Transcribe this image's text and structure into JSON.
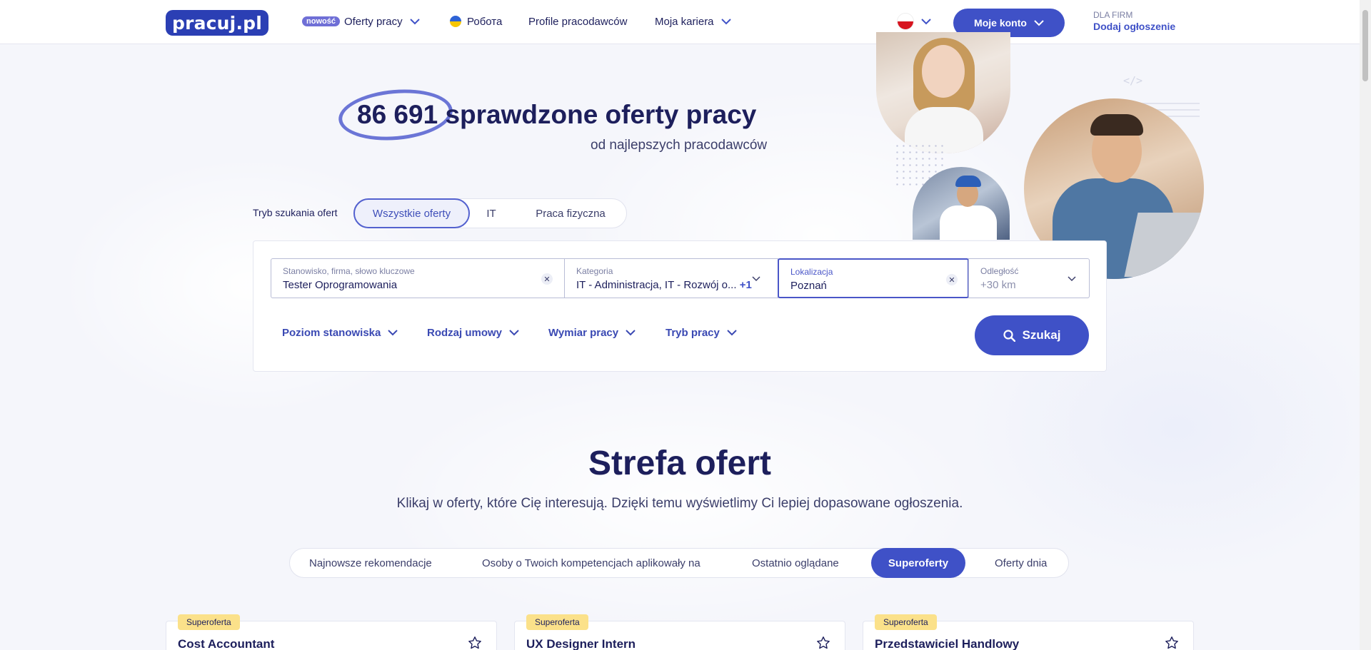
{
  "header": {
    "logo": "pracuj.pl",
    "nav": {
      "new_badge": "nowość",
      "offers": "Oferty pracy",
      "ukraine": "Робота",
      "employers": "Profile pracodawców",
      "career": "Moja kariera"
    },
    "account_button": "Moje konto",
    "for_firms_label": "DLA FIRM",
    "add_listing": "Dodaj ogłoszenie"
  },
  "hero": {
    "count": "86 691",
    "title_rest": "sprawdzone oferty pracy",
    "subtitle": "od najlepszych pracodawców",
    "code_deco": "</>"
  },
  "search_mode": {
    "label": "Tryb szukania ofert",
    "tabs": [
      "Wszystkie oferty",
      "IT",
      "Praca fizyczna"
    ],
    "active": "Wszystkie oferty"
  },
  "search": {
    "keyword": {
      "label": "Stanowisko, firma, słowo kluczowe",
      "value": "Tester Oprogramowania"
    },
    "category": {
      "label": "Kategoria",
      "value": "IT - Administracja, IT - Rozwój o...",
      "extra": "+1"
    },
    "location": {
      "label": "Lokalizacja",
      "value": "Poznań"
    },
    "distance": {
      "label": "Odległość",
      "value": "+30 km"
    },
    "filters": [
      "Poziom stanowiska",
      "Rodzaj umowy",
      "Wymiar pracy",
      "Tryb pracy"
    ],
    "search_button": "Szukaj"
  },
  "offers_zone": {
    "title": "Strefa ofert",
    "subtitle": "Klikaj w oferty, które Cię interesują. Dzięki temu wyświetlimy Ci lepiej dopasowane ogłoszenia.",
    "tabs": [
      "Najnowsze rekomendacje",
      "Osoby o Twoich kompetencjach aplikowały na",
      "Ostatnio oglądane",
      "Superoferty",
      "Oferty dnia"
    ],
    "active_tab": "Superoferty",
    "cards": [
      {
        "badge": "Superoferta",
        "title": "Cost Accountant"
      },
      {
        "badge": "Superoferta",
        "title": "UX Designer Intern"
      },
      {
        "badge": "Superoferta",
        "title": "Przedstawiciel Handlowy"
      }
    ]
  },
  "colors": {
    "brand": "#3f51c7",
    "navy": "#1d1f5c",
    "badge_yellow": "#fbe18a"
  }
}
